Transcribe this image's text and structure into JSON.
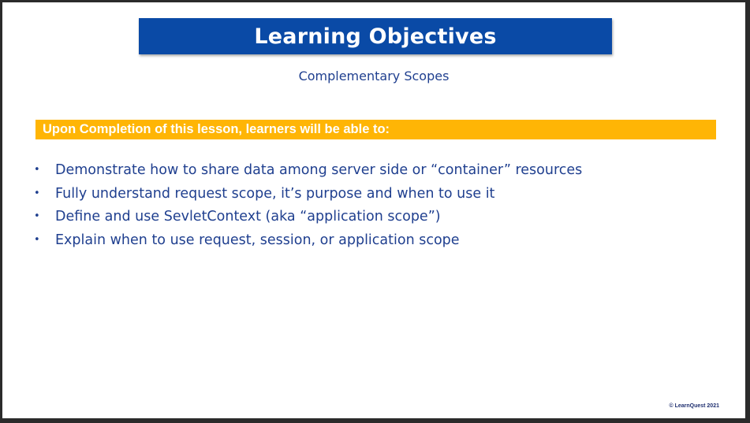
{
  "slide": {
    "title": "Learning Objectives",
    "subtitle": "Complementary Scopes",
    "banner": "Upon Completion of this lesson, learners will be able to:",
    "bullet_glyph": "•",
    "objectives": [
      "Demonstrate how to share data among server side or “container” resources",
      "Fully understand request scope, it’s purpose and when to use it",
      "Define and use SevletContext (aka “application scope”)",
      "Explain when to use request, session, or application scope"
    ],
    "copyright": "© LearnQuest 2021"
  },
  "colors": {
    "title_bar": "#0a4aa6",
    "banner": "#ffb505",
    "text": "#1f3f8f",
    "frame": "#2b2b2b"
  }
}
